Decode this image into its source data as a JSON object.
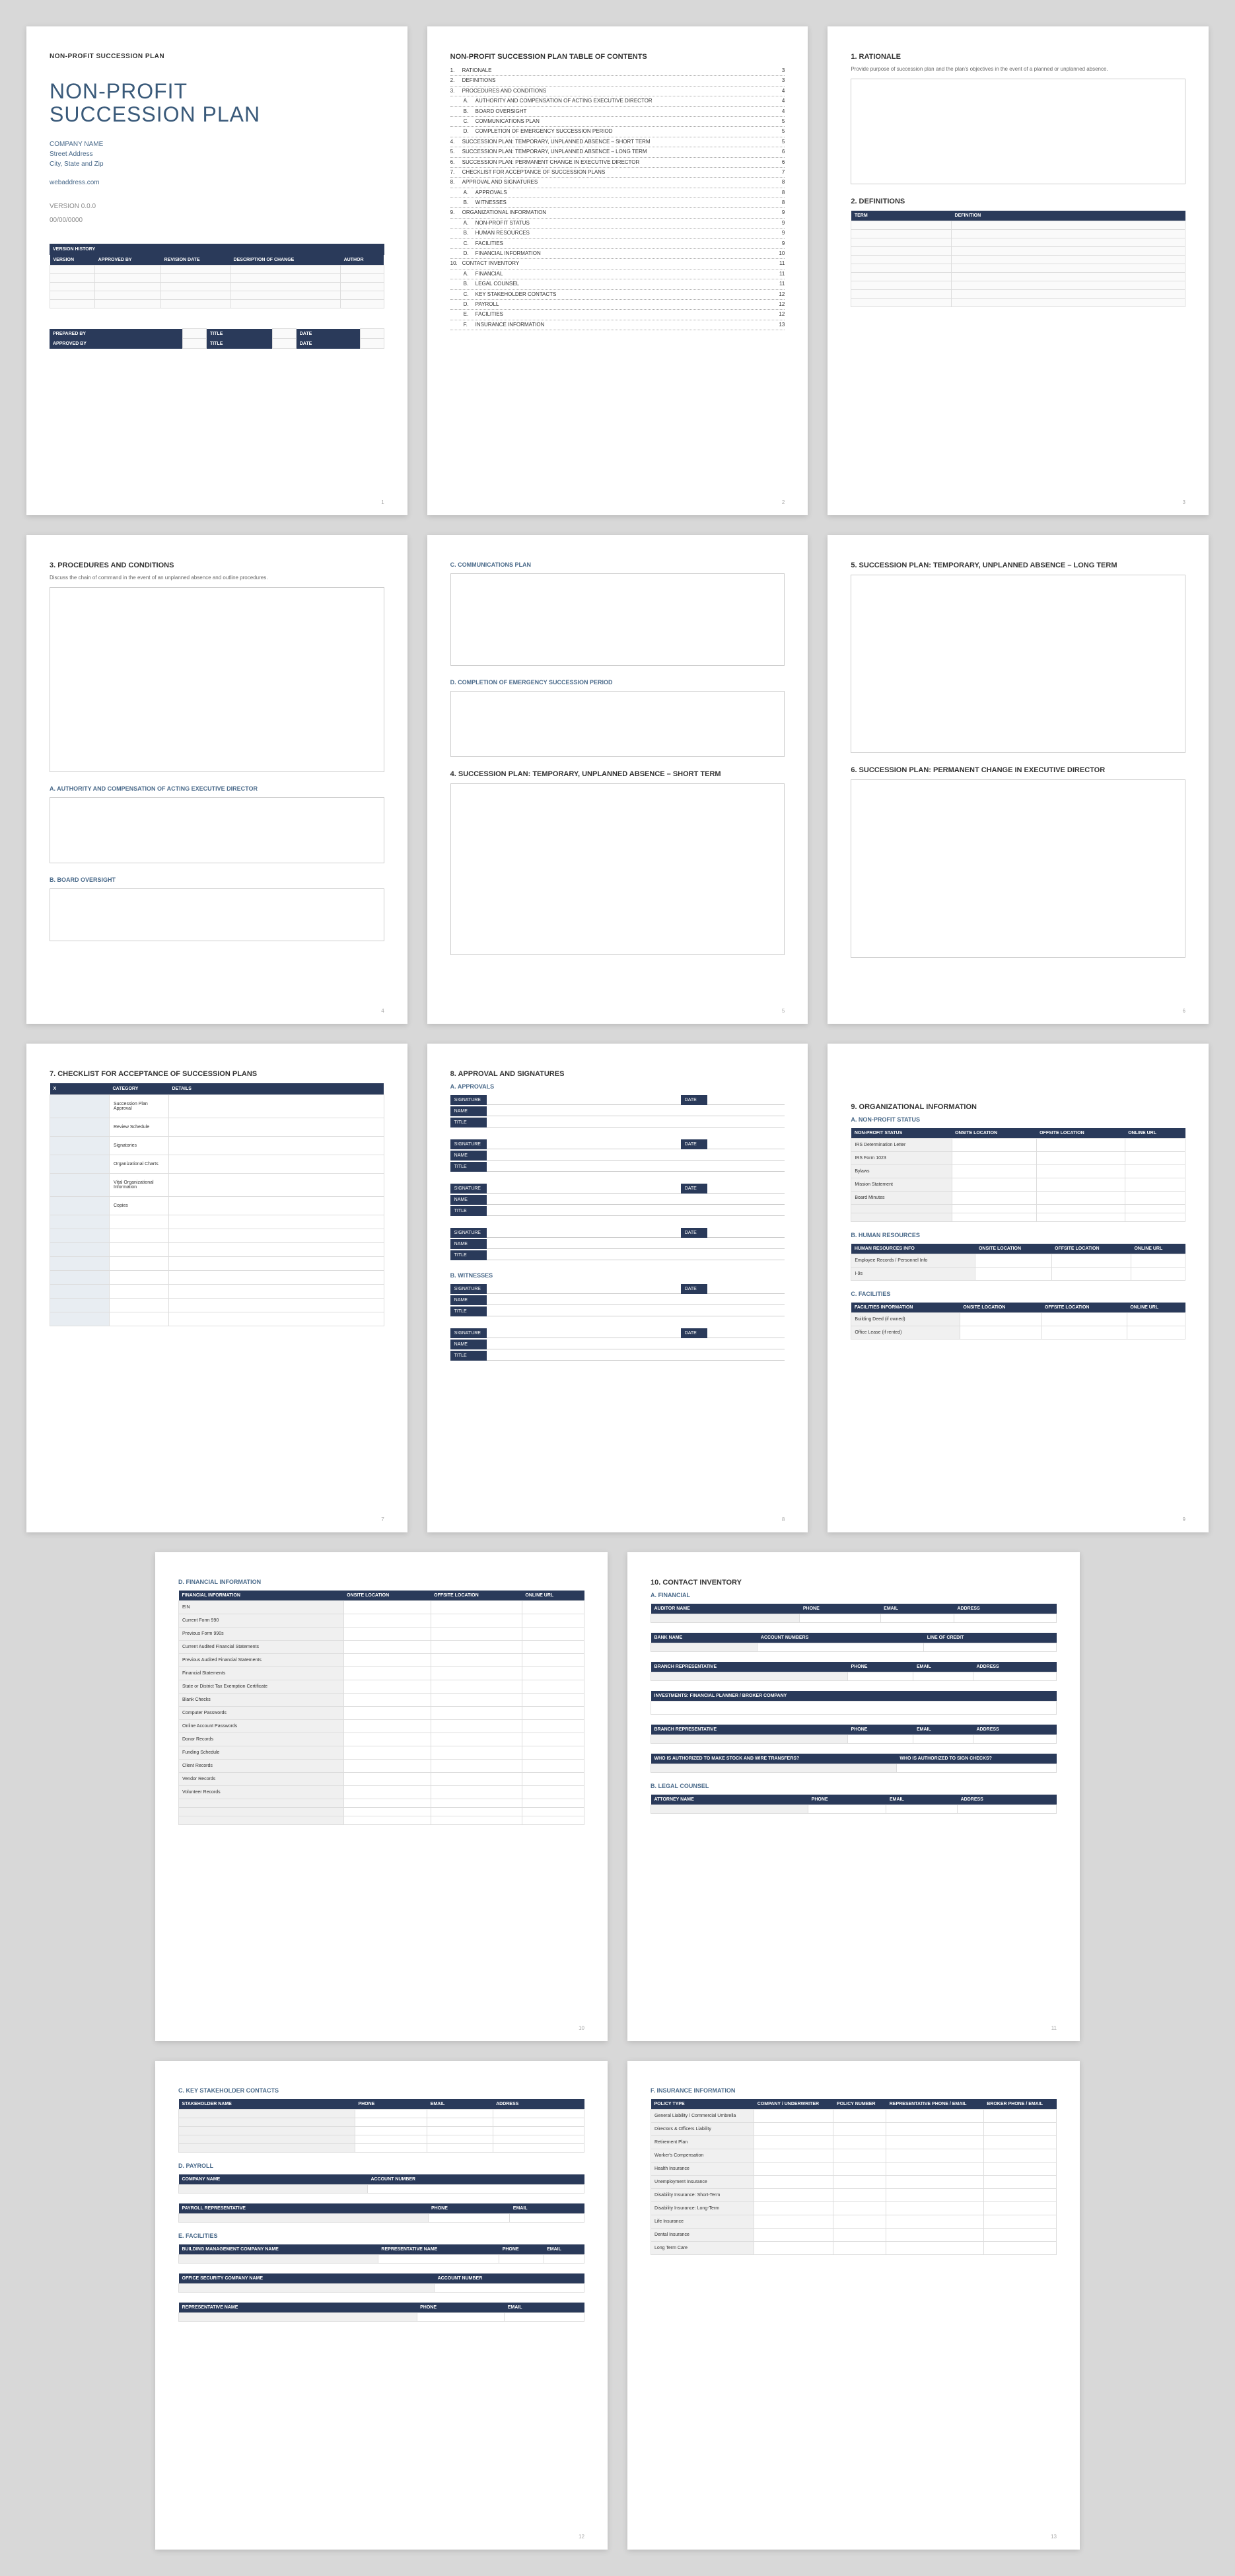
{
  "header": "NON-PROFIT SUCCESSION PLAN",
  "title1": "NON-PROFIT",
  "title2": "SUCCESSION PLAN",
  "company": {
    "name": "COMPANY NAME",
    "addr": "Street Address",
    "csz": "City, State and Zip",
    "web": "webaddress.com"
  },
  "version": "VERSION 0.0.0",
  "date": "00/00/0000",
  "vh_title": "VERSION HISTORY",
  "vh_cols": [
    "VERSION",
    "APPROVED BY",
    "REVISION DATE",
    "DESCRIPTION OF CHANGE",
    "AUTHOR"
  ],
  "prep": {
    "by": "PREPARED BY",
    "title": "TITLE",
    "date": "DATE"
  },
  "appr": {
    "by": "APPROVED BY",
    "title": "TITLE",
    "date": "DATE"
  },
  "toc_title": "NON-PROFIT SUCCESSION PLAN TABLE OF CONTENTS",
  "toc": [
    {
      "n": "1.",
      "t": "RATIONALE",
      "p": "3"
    },
    {
      "n": "2.",
      "t": "DEFINITIONS",
      "p": "3"
    },
    {
      "n": "3.",
      "t": "PROCEDURES AND CONDITIONS",
      "p": "4"
    },
    {
      "n": "A.",
      "t": "AUTHORITY AND COMPENSATION OF ACTING EXECUTIVE DIRECTOR",
      "p": "4",
      "s": 1
    },
    {
      "n": "B.",
      "t": "BOARD OVERSIGHT",
      "p": "4",
      "s": 1
    },
    {
      "n": "C.",
      "t": "COMMUNICATIONS PLAN",
      "p": "5",
      "s": 1
    },
    {
      "n": "D.",
      "t": "COMPLETION OF EMERGENCY SUCCESSION PERIOD",
      "p": "5",
      "s": 1
    },
    {
      "n": "4.",
      "t": "SUCCESSION PLAN: TEMPORARY, UNPLANNED ABSENCE – SHORT TERM",
      "p": "5"
    },
    {
      "n": "5.",
      "t": "SUCCESSION PLAN: TEMPORARY, UNPLANNED ABSENCE – LONG TERM",
      "p": "6"
    },
    {
      "n": "6.",
      "t": "SUCCESSION PLAN: PERMANENT CHANGE IN EXECUTIVE DIRECTOR",
      "p": "6"
    },
    {
      "n": "7.",
      "t": "CHECKLIST FOR ACCEPTANCE OF SUCCESSION PLANS",
      "p": "7"
    },
    {
      "n": "8.",
      "t": "APPROVAL AND SIGNATURES",
      "p": "8"
    },
    {
      "n": "A.",
      "t": "APPROVALS",
      "p": "8",
      "s": 1
    },
    {
      "n": "B.",
      "t": "WITNESSES",
      "p": "8",
      "s": 1
    },
    {
      "n": "9.",
      "t": "ORGANIZATIONAL INFORMATION",
      "p": "9"
    },
    {
      "n": "A.",
      "t": "NON-PROFIT STATUS",
      "p": "9",
      "s": 1
    },
    {
      "n": "B.",
      "t": "HUMAN RESOURCES",
      "p": "9",
      "s": 1
    },
    {
      "n": "C.",
      "t": "FACILITIES",
      "p": "9",
      "s": 1
    },
    {
      "n": "D.",
      "t": "FINANCIAL INFORMATION",
      "p": "10",
      "s": 1
    },
    {
      "n": "10.",
      "t": "CONTACT INVENTORY",
      "p": "11"
    },
    {
      "n": "A.",
      "t": "FINANCIAL",
      "p": "11",
      "s": 1
    },
    {
      "n": "B.",
      "t": "LEGAL COUNSEL",
      "p": "11",
      "s": 1
    },
    {
      "n": "C.",
      "t": "KEY STAKEHOLDER CONTACTS",
      "p": "12",
      "s": 1
    },
    {
      "n": "D.",
      "t": "PAYROLL",
      "p": "12",
      "s": 1
    },
    {
      "n": "E.",
      "t": "FACILITIES",
      "p": "12",
      "s": 1
    },
    {
      "n": "F.",
      "t": "INSURANCE INFORMATION",
      "p": "13",
      "s": 1
    }
  ],
  "s1": {
    "title": "1.  RATIONALE",
    "desc": "Provide purpose of succession plan and the plan's objectives in the event of a planned or unplanned absence."
  },
  "s2": {
    "title": "2.  DEFINITIONS",
    "cols": [
      "TERM",
      "DEFINITION"
    ]
  },
  "s3": {
    "title": "3.  PROCEDURES AND CONDITIONS",
    "desc": "Discuss the chain of command in the event of an unplanned absence and outline procedures.",
    "a": "A.  AUTHORITY AND COMPENSATION OF ACTING EXECUTIVE DIRECTOR",
    "b": "B.  BOARD OVERSIGHT",
    "c": "C.  COMMUNICATIONS PLAN",
    "d": "D.  COMPLETION OF EMERGENCY SUCCESSION PERIOD"
  },
  "s4": "4.  SUCCESSION PLAN: TEMPORARY, UNPLANNED ABSENCE – SHORT TERM",
  "s5": "5.  SUCCESSION PLAN: TEMPORARY, UNPLANNED ABSENCE – LONG TERM",
  "s6": "6.  SUCCESSION PLAN: PERMANENT CHANGE IN EXECUTIVE DIRECTOR",
  "s7": {
    "title": "7.  CHECKLIST FOR ACCEPTANCE OF SUCCESSION PLANS",
    "cols": [
      "X",
      "CATEGORY",
      "DETAILS"
    ],
    "rows": [
      "Succession Plan Approval",
      "Review Schedule",
      "Signatories",
      "Organizational Charts",
      "Vital Organizational Information",
      "Copies"
    ]
  },
  "s8": {
    "title": "8.  APPROVAL AND SIGNATURES",
    "a": "A.  APPROVALS",
    "b": "B.  WITNESSES",
    "sig": "SIGNATURE",
    "name": "NAME",
    "role": "TITLE",
    "date": "DATE"
  },
  "s9": {
    "title": "9.  ORGANIZATIONAL INFORMATION",
    "a": "A.  NON-PROFIT STATUS",
    "a_cols": [
      "NON-PROFIT STATUS",
      "ONSITE LOCATION",
      "OFFSITE LOCATION",
      "ONLINE URL"
    ],
    "a_rows": [
      "IRS Determination Letter",
      "IRS Form 1023",
      "Bylaws",
      "Mission Statement",
      "Board Minutes"
    ],
    "b": "B.  HUMAN RESOURCES",
    "b_cols": [
      "HUMAN RESOURCES INFO",
      "ONSITE LOCATION",
      "OFFSITE LOCATION",
      "ONLINE URL"
    ],
    "b_rows": [
      "Employee Records / Personnel Info",
      "I-9s"
    ],
    "c": "C.  FACILITIES",
    "c_cols": [
      "FACILITIES INFORMATION",
      "ONSITE LOCATION",
      "OFFSITE LOCATION",
      "ONLINE URL"
    ],
    "c_rows": [
      "Building Deed (if owned)",
      "Office Lease (if rented)"
    ],
    "d": "D.  FINANCIAL INFORMATION",
    "d_cols": [
      "FINANCIAL INFORMATION",
      "ONSITE LOCATION",
      "OFFSITE LOCATION",
      "ONLINE URL"
    ],
    "d_rows": [
      "EIN",
      "Current Form 990",
      "Previous Form 990s",
      "Current Audited Financial Statements",
      "Previous Audited Financial Statements",
      "Financial Statements",
      "State or District Tax Exemption Certificate",
      "Blank Checks",
      "Computer Passwords",
      "Online Account Passwords",
      "Donor Records",
      "Funding Schedule",
      "Client Records",
      "Vendor Records",
      "Volunteer Records"
    ]
  },
  "s10": {
    "title": "10.   CONTACT INVENTORY",
    "a": "A.  FINANCIAL",
    "aud_cols": [
      "AUDITOR NAME",
      "PHONE",
      "EMAIL",
      "ADDRESS"
    ],
    "bank_cols": [
      "BANK NAME",
      "ACCOUNT NUMBERS",
      "LINE OF CREDIT"
    ],
    "br_cols": [
      "BRANCH REPRESENTATIVE",
      "PHONE",
      "EMAIL",
      "ADDRESS"
    ],
    "inv": "INVESTMENTS: FINANCIAL PLANNER / BROKER COMPANY",
    "auth_cols": [
      "WHO IS AUTHORIZED TO MAKE STOCK AND WIRE TRANSFERS?",
      "WHO IS AUTHORIZED TO SIGN CHECKS?"
    ],
    "b": "B.  LEGAL COUNSEL",
    "b_cols": [
      "ATTORNEY NAME",
      "PHONE",
      "EMAIL",
      "ADDRESS"
    ],
    "c": "C.  KEY STAKEHOLDER CONTACTS",
    "c_cols": [
      "STAKEHOLDER NAME",
      "PHONE",
      "EMAIL",
      "ADDRESS"
    ],
    "d": "D.  PAYROLL",
    "d1_cols": [
      "COMPANY NAME",
      "ACCOUNT NUMBER"
    ],
    "d2_cols": [
      "PAYROLL REPRESENTATIVE",
      "PHONE",
      "EMAIL"
    ],
    "e": "E.  FACILITIES",
    "e1_cols": [
      "BUILDING MANAGEMENT COMPANY NAME",
      "REPRESENTATIVE NAME",
      "PHONE",
      "EMAIL"
    ],
    "e2_cols": [
      "OFFICE SECURITY COMPANY NAME",
      "ACCOUNT NUMBER"
    ],
    "e3_cols": [
      "REPRESENTATIVE NAME",
      "PHONE",
      "EMAIL"
    ],
    "f": "F.  INSURANCE INFORMATION",
    "f_cols": [
      "POLICY TYPE",
      "COMPANY / UNDERWRITER",
      "POLICY NUMBER",
      "REPRESENTATIVE PHONE / EMAIL",
      "BROKER PHONE / EMAIL"
    ],
    "f_rows": [
      "General Liability / Commercial Umbrella",
      "Directors & Officers Liability",
      "Retirement Plan",
      "Worker's Compensation",
      "Health Insurance",
      "Unemployment Insurance",
      "Disability Insurance: Short-Term",
      "Disability Insurance: Long-Term",
      "Life Insurance",
      "Dental Insurance",
      "Long Term Care"
    ]
  }
}
